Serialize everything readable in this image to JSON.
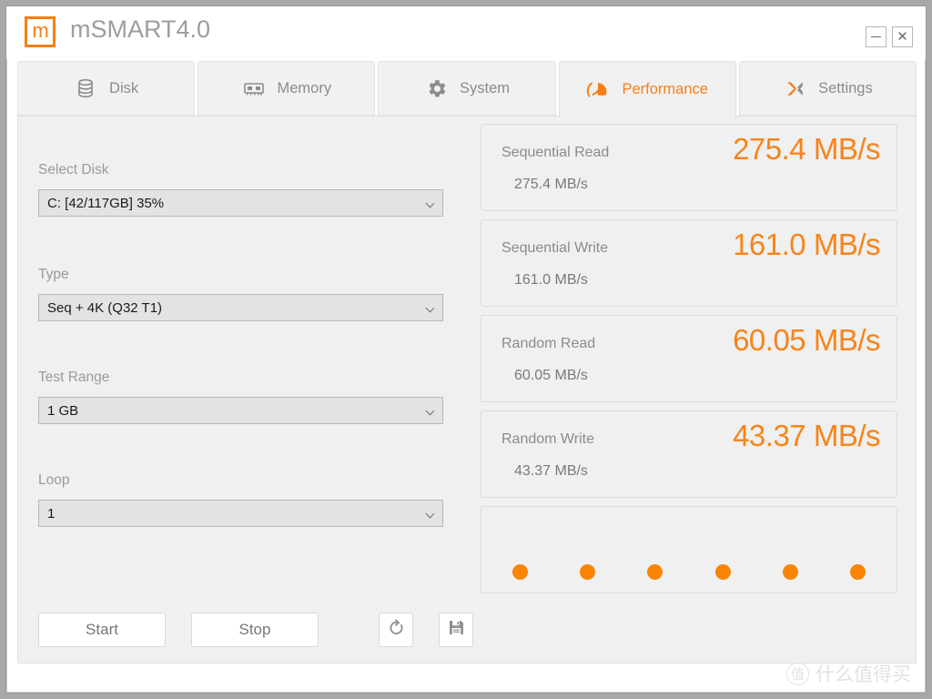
{
  "window": {
    "app_title": "mSMART4.0",
    "logo_letter": "m",
    "minimize_label": "",
    "close_label": "✕"
  },
  "tabs": [
    {
      "label": "Disk",
      "icon": "disk-icon",
      "active": false
    },
    {
      "label": "Memory",
      "icon": "memory-chip-icon",
      "active": false
    },
    {
      "label": "System",
      "icon": "gear-icon",
      "active": false
    },
    {
      "label": "Performance",
      "icon": "speedometer-icon",
      "active": true
    },
    {
      "label": "Settings",
      "icon": "settings-x-icon",
      "active": false
    }
  ],
  "form": {
    "select_disk": {
      "label": "Select Disk",
      "value": "C: [42/117GB] 35%"
    },
    "type": {
      "label": "Type",
      "value": "Seq + 4K (Q32 T1)"
    },
    "test_range": {
      "label": "Test Range",
      "value": "1 GB"
    },
    "loop": {
      "label": "Loop",
      "value": "1"
    }
  },
  "actions": {
    "start_label": "Start",
    "stop_label": "Stop",
    "refresh_icon": "refresh-icon",
    "save_icon": "save-floppy-icon"
  },
  "results": [
    {
      "title": "Sequential Read",
      "value": "275.4 MB/s",
      "sub": "275.4 MB/s"
    },
    {
      "title": "Sequential Write",
      "value": "161.0 MB/s",
      "sub": "161.0 MB/s"
    },
    {
      "title": "Random Read",
      "value": "60.05 MB/s",
      "sub": "60.05 MB/s"
    },
    {
      "title": "Random Write",
      "value": "43.37 MB/s",
      "sub": "43.37 MB/s"
    }
  ],
  "progress_dots": {
    "count": 6,
    "color": "#fa8404"
  },
  "watermark": {
    "mark": "值",
    "text": "什么值得买"
  },
  "colors": {
    "accent": "#f77f16",
    "value_orange": "#f7841a",
    "label_gray": "#9a9a9a",
    "panel_bg": "#f0f0f0",
    "select_bg": "#e3e3e3"
  }
}
